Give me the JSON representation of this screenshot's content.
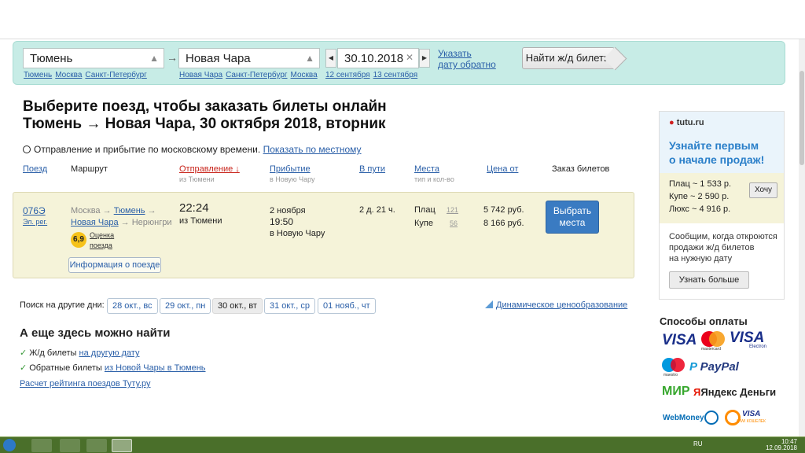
{
  "search": {
    "from_value": "Тюмень",
    "from_hints": [
      "Тюмень",
      "Москва",
      "Санкт-Петербург"
    ],
    "to_value": "Новая Чара",
    "to_hints": [
      "Новая Чара",
      "Санкт-Петербург",
      "Москва"
    ],
    "arrow": "→",
    "date_value": "30.10.2018",
    "date_hints": [
      "12 сентября",
      "13 сентября"
    ],
    "return_line1": "Указать",
    "return_line2": "дату обратно",
    "find_button": "Найти ж/д билеты"
  },
  "page": {
    "title_line1": "Выберите поезд, чтобы заказать билеты онлайн",
    "title_line2": "Тюмень → Новая Чара, 30 октября 2018, вторник",
    "time_note": "Отправление и прибытие по московскому времени.",
    "time_link": "Показать по местному"
  },
  "table": {
    "headers": {
      "train": "Поезд",
      "route": "Маршрут",
      "departure": "Отправление ↓",
      "departure_sub": "из Тюмени",
      "arrival": "Прибытие",
      "arrival_sub": "в Новую Чару",
      "travel": "В пути",
      "seats": "Места",
      "seats_sub": "тип и кол-во",
      "price": "Цена от",
      "order": "Заказ билетов"
    },
    "row": {
      "number": "076Э",
      "type": "Эл. рег.",
      "route_from": "Москва",
      "route_arrow1": "→",
      "route_city": "Тюмень",
      "route_arrow2": "→",
      "route_to": "Новая Чара",
      "route_arrow3": "→",
      "route_end": "Нерюнгри",
      "rating": "6,9",
      "rating_label1": "Оценка",
      "rating_label2": "поезда",
      "dep_time": "22:24",
      "dep_from": "из Тюмени",
      "arr_date": "2 ноября",
      "arr_time": "19:50",
      "arr_to": "в Новую Чару",
      "duration": "2 д. 21 ч.",
      "seats": [
        {
          "type": "Плац",
          "count": "121",
          "price": "5 742 руб."
        },
        {
          "type": "Купе",
          "count": "56",
          "price": "8 166 руб."
        }
      ],
      "choose_line1": "Выбрать",
      "choose_line2": "места",
      "info_button": "Информация о поезде"
    }
  },
  "other_days": {
    "label": "Поиск на другие дни:",
    "days": [
      "28 окт., вс",
      "29 окт., пн",
      "30 окт., вт",
      "31 окт., ср",
      "01 нояб., чт"
    ],
    "dynamic_pricing": "Динамическое ценообразование"
  },
  "also": {
    "title": "А еще здесь можно найти",
    "item1_text": "Ж/д билеты",
    "item1_link": "на другую дату",
    "item2_text": "Обратные билеты",
    "item2_link": "из Новой Чары в Тюмень",
    "rating_link": "Расчет рейтинга поездов Туту.ру"
  },
  "promo": {
    "logo": "tutu.ru",
    "headline1": "Узнайте первым",
    "headline2": "о начале продаж!",
    "prices": [
      {
        "type": "Плац",
        "price": "~ 1 533 р."
      },
      {
        "type": "Купе",
        "price": "~ 2 590 р."
      },
      {
        "type": "Люкс",
        "price": "~ 4 916 р."
      }
    ],
    "want_button": "Хочу",
    "text1": "Сообщим, когда откроются",
    "text2": "продажи ж/д билетов",
    "text3": "на нужную дату",
    "learn_button": "Узнать больше"
  },
  "payment": {
    "title": "Способы оплаты",
    "visa": "VISA",
    "mastercard": "mastercard",
    "visa_electron": "VISA",
    "electron": "Electron",
    "maestro": "maestro",
    "paypal": "PayPal",
    "mir": "МИР",
    "yandex": "Яндекс Деньги",
    "webmoney": "WebMoney",
    "qiwi": "VISA",
    "qiwi_sub": "QIWI КОШЕЛЕК"
  },
  "taskbar": {
    "lang": "RU",
    "time": "10:47",
    "date": "12.09.2018"
  },
  "colors": {
    "search_bg": "#c7ece6",
    "row_bg": "#f5f3d9",
    "accent": "#3a7bc2",
    "link": "#2a5fa8",
    "sort_red": "#c8241b"
  }
}
